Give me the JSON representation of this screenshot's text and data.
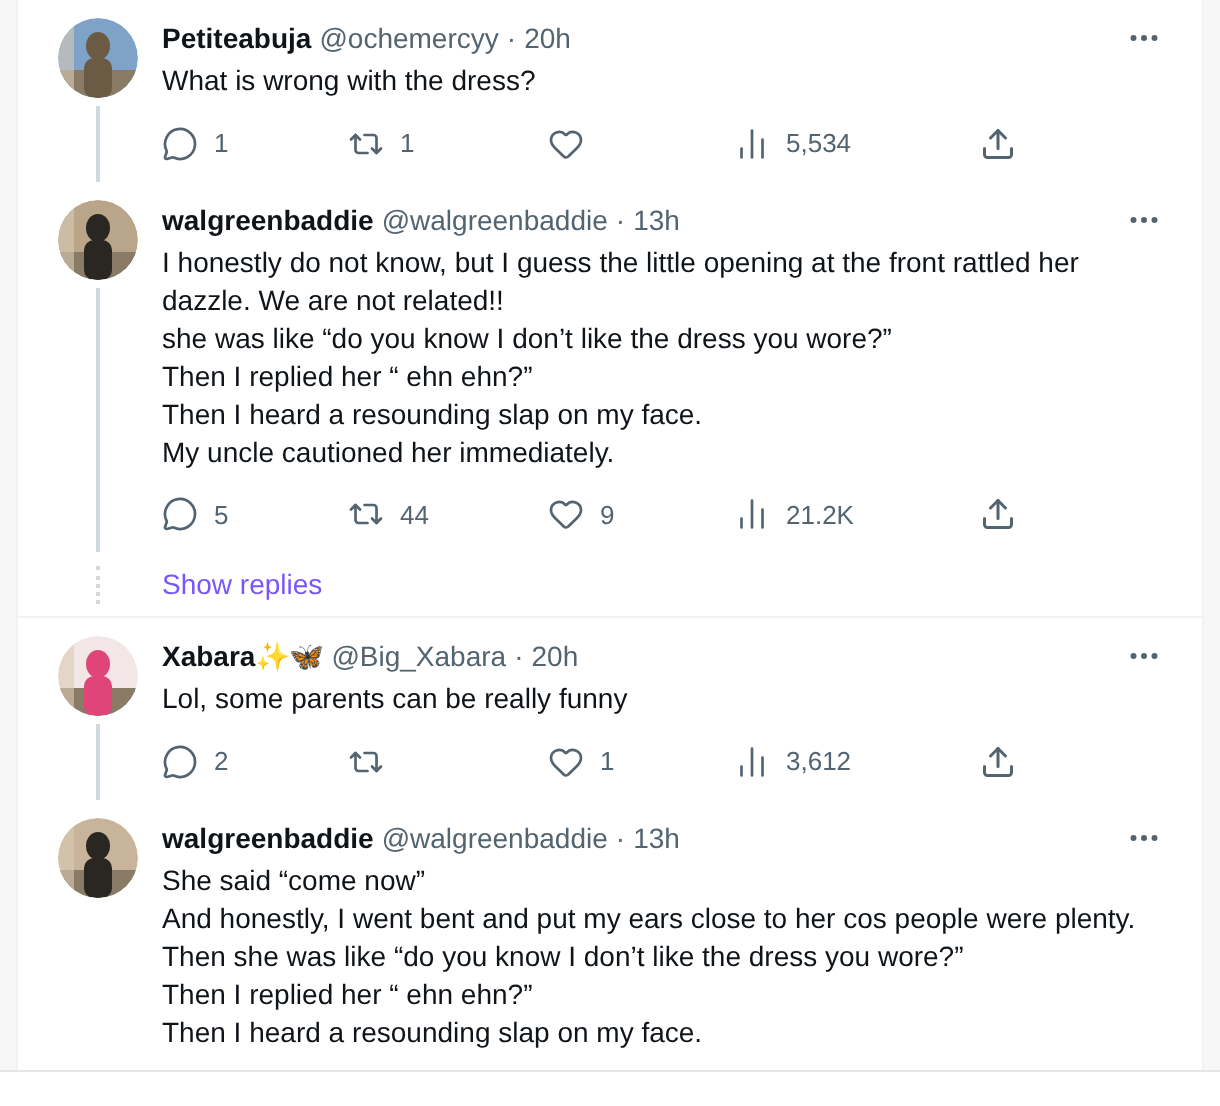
{
  "threads": [
    {
      "tweets": [
        {
          "name": "Petiteabuja",
          "handle": "@ochemercyy",
          "separator": "·",
          "time": "20h",
          "text": [
            "What is wrong with the dress?"
          ],
          "stats": {
            "replies": "1",
            "reposts": "1",
            "views": "5,534"
          }
        },
        {
          "name": "walgreenbaddie",
          "handle": "@walgreenbaddie",
          "separator": "·",
          "time": "13h",
          "text": [
            "I honestly do not know, but I guess the little opening at the front rattled her dazzle. We are not related!!",
            "she was like “do you know I don’t like the dress you wore?”",
            "Then I replied her “ ehn ehn?”",
            "Then I heard a resounding slap on my face.",
            "My uncle cautioned her immediately."
          ],
          "stats": {
            "replies": "5",
            "reposts": "44",
            "likes": "9",
            "views": "21.2K"
          }
        }
      ],
      "show_replies": "Show replies"
    },
    {
      "tweets": [
        {
          "name": "Xabara✨🦋",
          "handle": "@Big_Xabara",
          "separator": "·",
          "time": "20h",
          "text": [
            "Lol, some parents can be really funny"
          ],
          "stats": {
            "replies": "2",
            "likes": "1",
            "views": "3,612"
          }
        },
        {
          "name": "walgreenbaddie",
          "handle": "@walgreenbaddie",
          "separator": "·",
          "time": "13h",
          "text": [
            "She said “come now”",
            "And honestly, I went bent and put my ears close to her cos people were plenty.",
            "Then she was like “do you know I don’t like the dress you wore?”",
            "Then I replied her “ ehn ehn?”",
            "Then I heard a resounding slap on my face."
          ]
        }
      ]
    }
  ]
}
